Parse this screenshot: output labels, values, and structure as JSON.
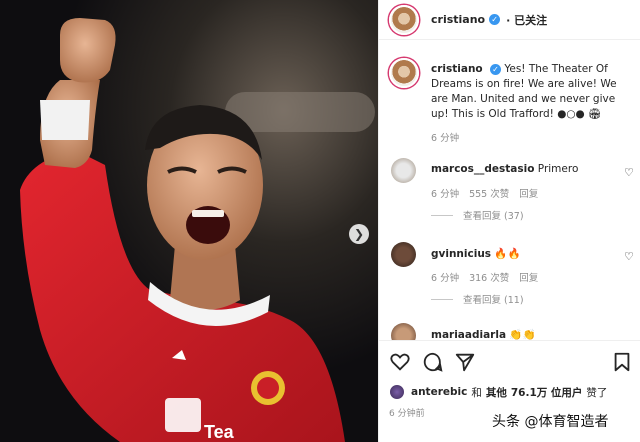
{
  "post": {
    "username": "cristiano",
    "follow_status": "· 已关注",
    "caption": "Yes! The Theater Of Dreams is on fire! We are alive! We are Man. United and we never give up! This is Old Trafford! ●○● 🏟",
    "time": "6 分钟"
  },
  "comments": [
    {
      "user": "marcos__destasio",
      "text": "Primero",
      "time": "6 分钟",
      "likes": "555 次赞",
      "reply": "回复",
      "view_replies": "查看回复 (37)"
    },
    {
      "user": "gvinnicius",
      "text": "🔥🔥",
      "time": "6 分钟",
      "likes": "316 次赞",
      "reply": "回复",
      "view_replies": "查看回复 (11)"
    },
    {
      "user": "mariaadiarla",
      "text": "👏👏"
    }
  ],
  "likes": {
    "user": "anterebic",
    "text1": "和",
    "text2": "其他",
    "count": "76.1万 位用户",
    "text3": "赞了"
  },
  "posted": "6 分钟前",
  "watermark": "头条 @体育智造者",
  "icons": [
    "heart-icon",
    "comment-icon",
    "share-icon",
    "bookmark-icon",
    "next-arrow-icon",
    "verified-icon"
  ],
  "colors": {
    "verified": "#3897f0",
    "jersey": "#d8242c",
    "text": "#262626",
    "muted": "#8e8e8e"
  }
}
